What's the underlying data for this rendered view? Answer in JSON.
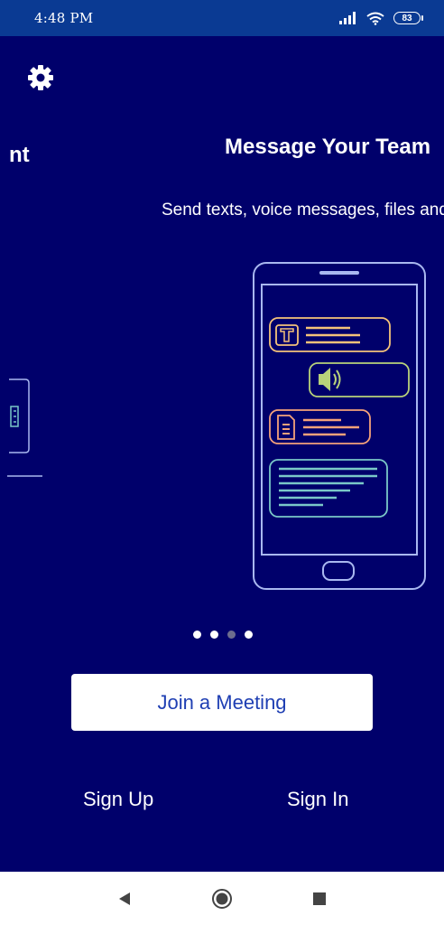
{
  "status_bar": {
    "time": "4:48 PM",
    "battery": "83"
  },
  "carousel": {
    "prev_title_fragment": "nt",
    "title": "Message Your Team",
    "description": "Send texts, voice messages, files and images",
    "dots_count": 4,
    "active_dot": 2
  },
  "actions": {
    "join_label": "Join a Meeting",
    "sign_up_label": "Sign Up",
    "sign_in_label": "Sign In"
  },
  "icons": {
    "settings": "gear-icon",
    "nav_back": "back-triangle-icon",
    "nav_home": "home-circle-icon",
    "nav_recents": "recents-square-icon"
  },
  "colors": {
    "background": "#00006b",
    "status_bar": "#0a3a93",
    "accent_text": "#1f3fb3",
    "bubble_text": "#f5c37a",
    "bubble_voice": "#b8d27a",
    "bubble_file": "#f5a27a",
    "bubble_message": "#7ac8c8",
    "phone_outline": "#a9b8f0"
  }
}
